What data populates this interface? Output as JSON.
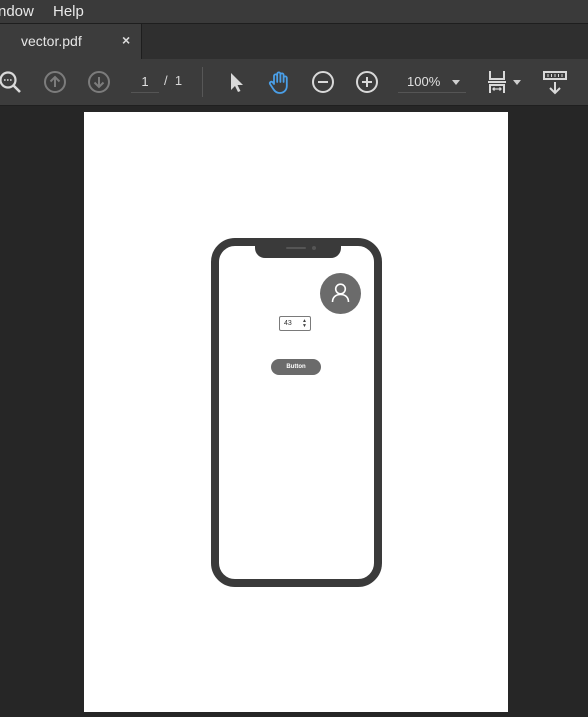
{
  "menubar": {
    "items": [
      "ndow",
      "Help"
    ]
  },
  "tab": {
    "title": "vector.pdf",
    "close": "×"
  },
  "toolbar": {
    "page_current": "1",
    "page_separator": "/",
    "page_total": "1",
    "zoom": "100%",
    "icons": [
      "zoom-search-icon",
      "previous-page-icon",
      "next-page-icon",
      "select-cursor-icon",
      "hand-tool-icon",
      "zoom-out-icon",
      "zoom-in-icon",
      "fit-page-icon",
      "read-mode-icon"
    ],
    "accent_color": "#4a9fe8"
  },
  "document": {
    "stepper_value": "43",
    "button_label": "Button",
    "avatar_icon": "user-icon"
  }
}
